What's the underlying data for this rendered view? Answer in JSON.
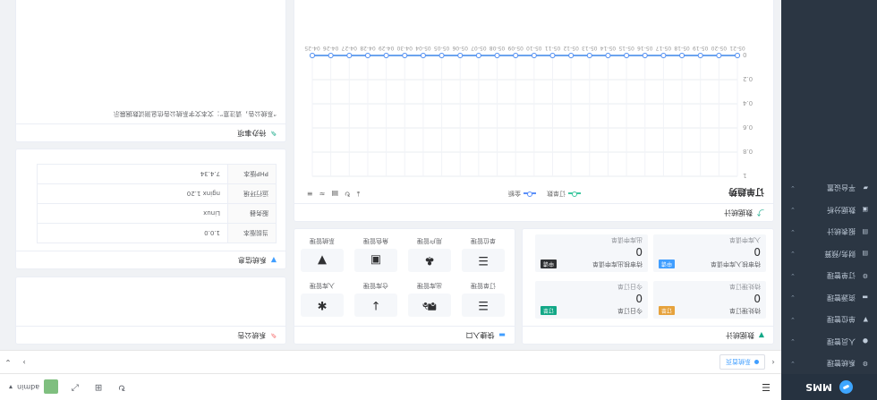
{
  "app": {
    "logo_text": "MMS",
    "brand_color": "#3ea6ff"
  },
  "sidebar": {
    "items": [
      {
        "label": "系统管理",
        "icon": "gear-icon",
        "glyph": "⚙"
      },
      {
        "label": "人员管理",
        "icon": "user-icon",
        "glyph": "●"
      },
      {
        "label": "单位管理",
        "icon": "building-icon",
        "glyph": "▼"
      },
      {
        "label": "资源管理",
        "icon": "folder-icon",
        "glyph": "▬"
      },
      {
        "label": "订单管理",
        "icon": "order-icon",
        "glyph": "⚙"
      },
      {
        "label": "财务/预算",
        "icon": "money-icon",
        "glyph": "▤"
      },
      {
        "label": "报表统计",
        "icon": "list-icon",
        "glyph": "▤"
      },
      {
        "label": "数据分析",
        "icon": "chart-icon",
        "glyph": "▣"
      },
      {
        "label": "平台设置",
        "icon": "settings-icon",
        "glyph": "▰"
      }
    ]
  },
  "header": {
    "user_name": "admin",
    "user_arrow": "▾"
  },
  "tags": {
    "active_tag": "系统首页"
  },
  "cards": {
    "stats_title": "数据统计",
    "entries_title": "快捷入口",
    "sysinfo_title": "系统信息",
    "tasks_title": "待办事项",
    "notice_title": "系统公告",
    "notice_text": "“系统公告，请注意”：文本文字系统公告信息测试数据展示",
    "trend_title": "订单趋势",
    "trend_header": "数据统计"
  },
  "stats": [
    {
      "title": "待处理订单",
      "value": "0",
      "sub": "待处理订单",
      "badge": "订单",
      "badge_color": "#e6a23c"
    },
    {
      "title": "今日订单",
      "value": "0",
      "sub": "今日订单",
      "badge": "订单",
      "badge_color": "#13a887"
    },
    {
      "title": "待审核入库申请单",
      "value": "0",
      "sub": "入库申请单",
      "badge": "申请",
      "badge_color": "#409eff"
    },
    {
      "title": "待审核出库申请单",
      "value": "0",
      "sub": "出库申请单",
      "badge": "申请",
      "badge_color": "#303133"
    }
  ],
  "entries": [
    {
      "label": "订单管理",
      "icon": "list-icon",
      "glyph": "☰"
    },
    {
      "label": "出库管理",
      "icon": "truck-icon",
      "glyph": "⛟"
    },
    {
      "label": "仓库管理",
      "icon": "down-arrow-icon",
      "glyph": "↓"
    },
    {
      "label": "入库管理",
      "icon": "star-icon",
      "glyph": "✱"
    },
    {
      "label": "单位管理",
      "icon": "list2-icon",
      "glyph": "☰"
    },
    {
      "label": "用户管理",
      "icon": "tree-icon",
      "glyph": "♣"
    },
    {
      "label": "角色管理",
      "icon": "id-card-icon",
      "glyph": "▣"
    },
    {
      "label": "系统管理",
      "icon": "marker-icon",
      "glyph": "▼"
    }
  ],
  "sysinfo": [
    {
      "k": "当前版本",
      "v": "1.0.0"
    },
    {
      "k": "服务器",
      "v": "Linux"
    },
    {
      "k": "运行环境",
      "v": "nginx 1.20"
    },
    {
      "k": "PHP版本",
      "v": "7.4.34"
    }
  ],
  "chart_data": [
    {
      "type": "line",
      "title": "订单趋势",
      "x": [
        "05-21",
        "05-20",
        "05-19",
        "05-18",
        "05-17",
        "05-16",
        "05-15",
        "05-14",
        "05-13",
        "05-12",
        "05-11",
        "05-10",
        "05-09",
        "05-08",
        "05-07",
        "05-06",
        "05-05",
        "05-04",
        "04-30",
        "04-29",
        "04-28",
        "04-27",
        "04-26",
        "04-25"
      ],
      "series": [
        {
          "name": "订单数",
          "values": [
            0,
            0,
            0,
            0,
            0,
            0,
            0,
            0,
            0,
            0,
            0,
            0,
            0,
            0,
            0,
            0,
            0,
            0,
            0,
            0,
            0,
            0,
            0,
            0
          ],
          "color": "#3fc7a0"
        },
        {
          "name": "金额",
          "values": [
            0,
            0,
            0,
            0,
            0,
            0,
            0,
            0,
            0,
            0,
            0,
            0,
            0,
            0,
            0,
            0,
            0,
            0,
            0,
            0,
            0,
            0,
            0,
            0
          ],
          "color": "#5b8ff9"
        }
      ],
      "yticks": [
        "1",
        "0.8",
        "0.6",
        "0.4",
        "0.2",
        "0"
      ],
      "ylim": [
        0,
        1
      ],
      "legend": "top-center",
      "grid": true
    }
  ],
  "toolbar_icons": [
    "download-icon",
    "refresh-icon",
    "view-icon",
    "line-icon",
    "bar-icon"
  ]
}
